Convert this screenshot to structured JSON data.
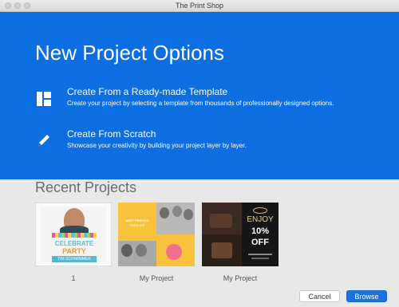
{
  "window": {
    "title": "The Print Shop"
  },
  "hero": {
    "title": "New Project Options",
    "options": [
      {
        "title": "Create From a Ready-made Template",
        "description": "Create your project by selecting a template from thousands of professionally designed options.",
        "icon": "template-layout-icon"
      },
      {
        "title": "Create From Scratch",
        "description": "Showcase your creativity by building your project layer by layer.",
        "icon": "pencil-icon"
      }
    ]
  },
  "recent": {
    "title": "Recent Projects",
    "projects": [
      {
        "label": "1",
        "thumb_text": [
          "CELEBRATE",
          "PARTY",
          "TIM SCHWIMMER"
        ]
      },
      {
        "label": "My Project",
        "thumb_text": [
          "BEST FRIENDS",
          "FOREVER"
        ]
      },
      {
        "label": "My Project",
        "thumb_text": [
          "ENJOY",
          "10%",
          "OFF"
        ]
      }
    ]
  },
  "buttons": {
    "cancel": "Cancel",
    "browse": "Browse"
  },
  "colors": {
    "hero": "#0c6ee0",
    "accent": "#1c73df"
  }
}
